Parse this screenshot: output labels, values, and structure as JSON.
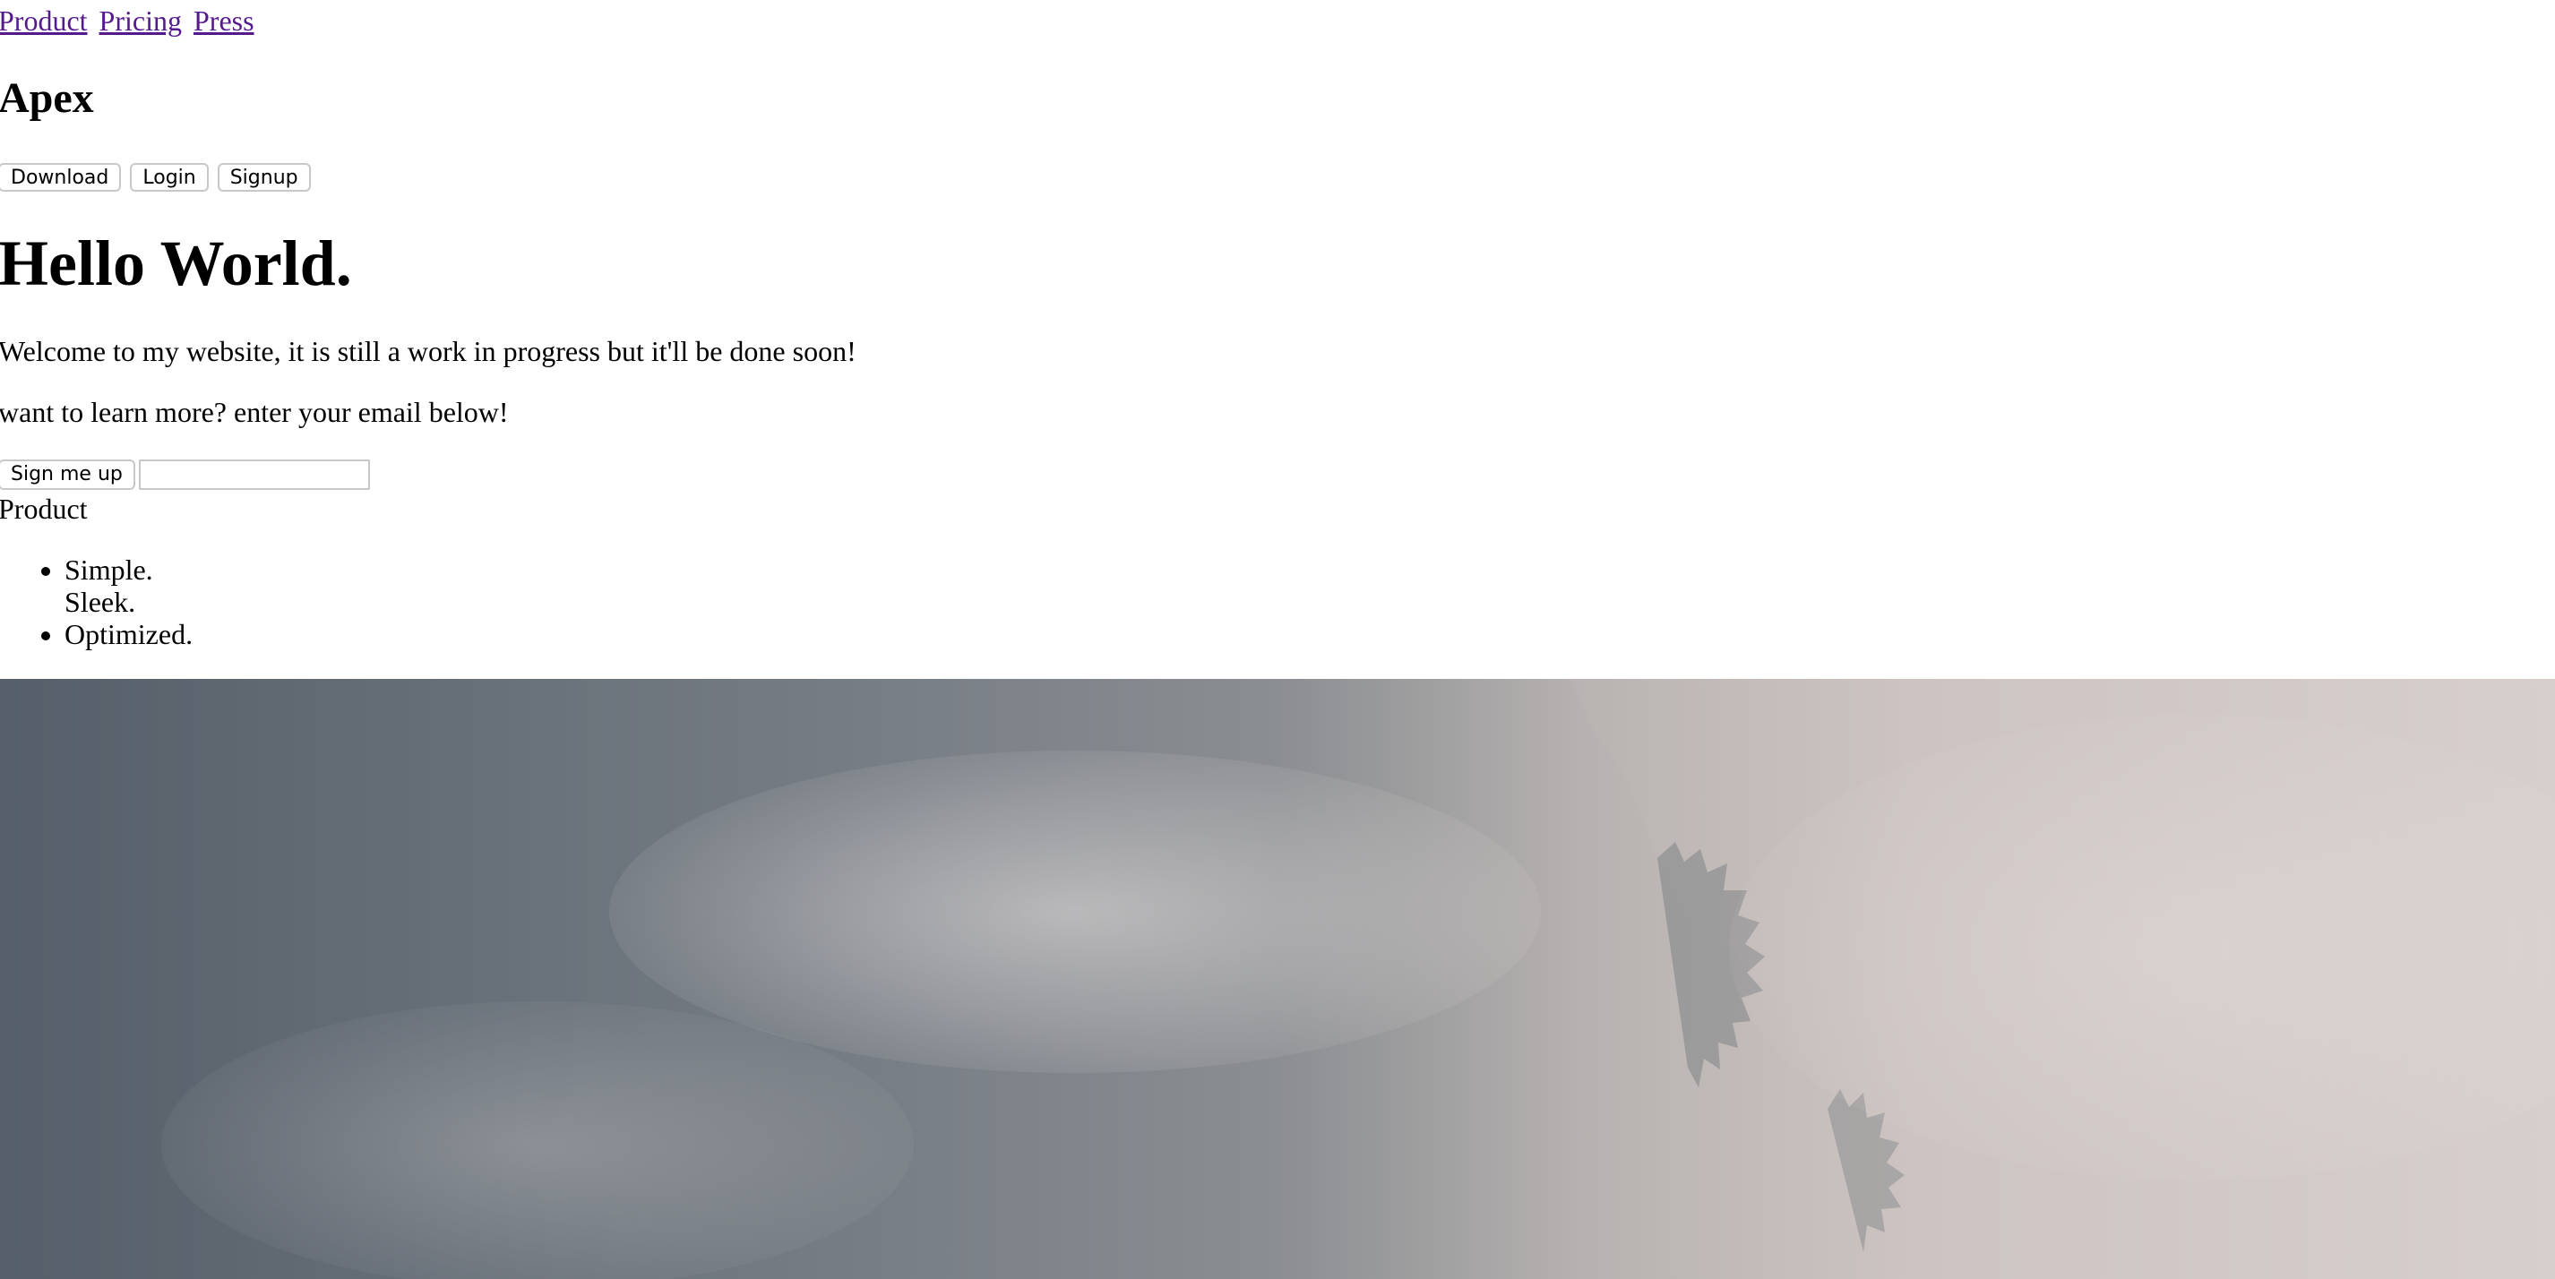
{
  "nav": {
    "links": [
      "Product",
      "Pricing",
      "Press"
    ]
  },
  "brand": {
    "name": "Apex"
  },
  "header_buttons": [
    "Download",
    "Login",
    "Signup"
  ],
  "hero": {
    "title": "Hello World.",
    "subtitle": "Welcome to my website, it is still a work in progress but it'll be done soon!",
    "cta_text": "want to learn more? enter your email below!"
  },
  "signup": {
    "button_label": "Sign me up",
    "email_value": "",
    "email_placeholder": ""
  },
  "product": {
    "label": "Product",
    "features": [
      "Simple.",
      "Sleek.",
      "Optimized."
    ]
  },
  "hero_image": {
    "description_icon": "foggy-forest-image",
    "colors": [
      "#5e6670",
      "#8c8f93",
      "#d7cfcc"
    ]
  }
}
